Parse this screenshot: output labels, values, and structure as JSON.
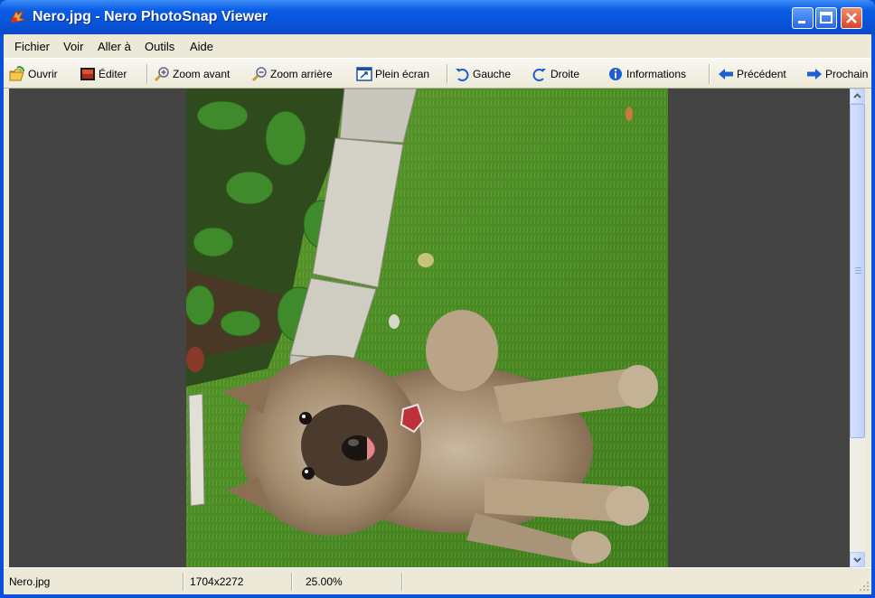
{
  "window": {
    "title": "Nero.jpg - Nero PhotoSnap Viewer",
    "icon": "nero-photosnap-icon",
    "controls": [
      "minimize",
      "maximize",
      "close"
    ]
  },
  "menubar": {
    "items": [
      {
        "label": "Fichier"
      },
      {
        "label": "Voir"
      },
      {
        "label": "Aller à"
      },
      {
        "label": "Outils"
      },
      {
        "label": "Aide"
      }
    ]
  },
  "toolbar": {
    "open": {
      "label": "Ouvrir",
      "icon": "folder-open-icon"
    },
    "edit": {
      "label": "Éditer",
      "icon": "edit-image-icon"
    },
    "zoom_in": {
      "label": "Zoom avant",
      "icon": "zoom-in-icon"
    },
    "zoom_out": {
      "label": "Zoom arrière",
      "icon": "zoom-out-icon"
    },
    "fullscreen": {
      "label": "Plein écran",
      "icon": "fullscreen-icon"
    },
    "rotate_left": {
      "label": "Gauche",
      "icon": "rotate-left-icon"
    },
    "rotate_right": {
      "label": "Droite",
      "icon": "rotate-right-icon"
    },
    "info": {
      "label": "Informations",
      "icon": "info-icon"
    },
    "previous": {
      "label": "Précédent",
      "icon": "arrow-left-icon"
    },
    "next": {
      "label": "Prochain",
      "icon": "arrow-right-icon"
    }
  },
  "viewer": {
    "image_subject": "fluffy puppy lying on grass (rotated)",
    "background_color": "#444444"
  },
  "statusbar": {
    "filename": "Nero.jpg",
    "dimensions": "1704x2272",
    "zoom": "25.00%"
  },
  "colors": {
    "titlebar": "#0a5ce6",
    "chrome": "#ece9d8",
    "close_button": "#d8432a"
  }
}
